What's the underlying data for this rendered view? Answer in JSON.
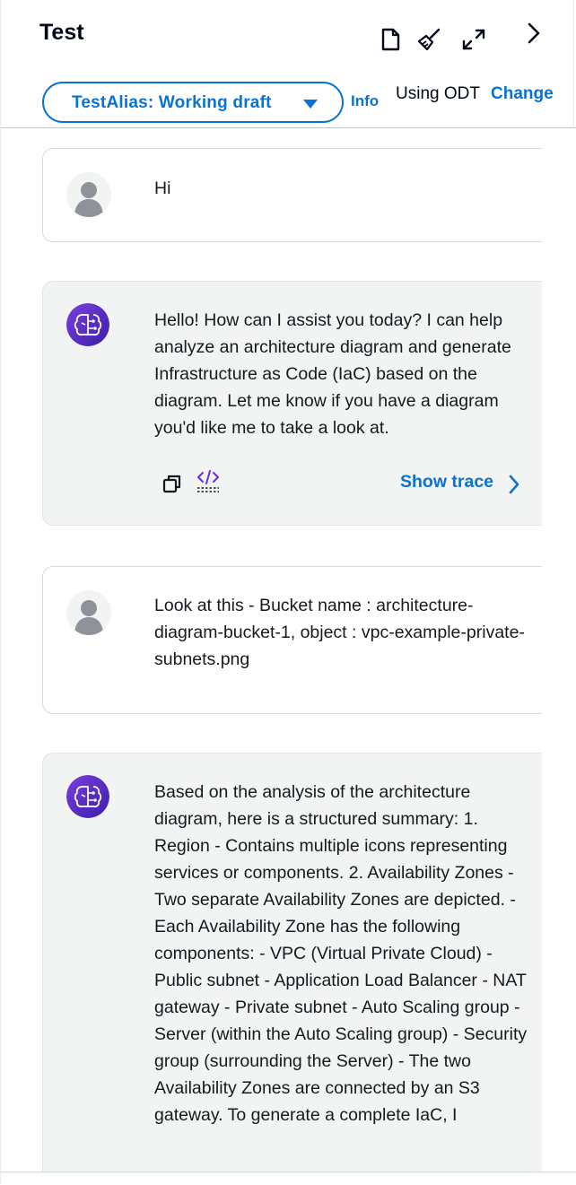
{
  "header": {
    "title": "Test",
    "icons": [
      "document-icon",
      "broom-icon",
      "expand-icon",
      "chevron-right-icon"
    ],
    "alias_label": "TestAlias: Working draft",
    "info_label": "Info",
    "using_text": "Using ODT",
    "change_label": "Change"
  },
  "messages": [
    {
      "role": "user",
      "text": "Hi"
    },
    {
      "role": "agent",
      "text": "Hello! How can I assist you today? I can help analyze an architecture diagram and generate Infrastructure as Code (IaC) based on the diagram. Let me know if you have a diagram you'd like me to take a look at.",
      "actions": [
        "copy-icon",
        "code-icon"
      ],
      "show_trace_label": "Show trace"
    },
    {
      "role": "user",
      "text": "Look at this - Bucket name : architecture-diagram-bucket-1, object : vpc-example-private-subnets.png"
    },
    {
      "role": "agent",
      "text": "Based on the analysis of the architecture diagram, here is a structured summary: 1. Region - Contains multiple icons representing services or components. 2. Availability Zones - Two separate Availability Zones are depicted. - Each Availability Zone has the following components: - VPC (Virtual Private Cloud) - Public subnet - Application Load Balancer - NAT gateway - Private subnet - Auto Scaling group - Server (within the Auto Scaling group) - Security group (surrounding the Server) - The two Availability Zones are connected by an S3 gateway. To generate a complete IaC, I"
    }
  ],
  "colors": {
    "accent": "#0972d3",
    "agent_avatar": "#5a2fc6",
    "agent_bubble": "#f2f3f3"
  }
}
